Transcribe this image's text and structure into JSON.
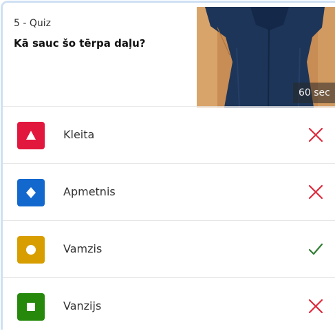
{
  "quiz": {
    "label": "5 - Quiz",
    "question": "Kā sauc šo tērpa daļu?",
    "timer": "60 sec"
  },
  "answers": [
    {
      "label": "Kleita",
      "shape": "triangle-icon",
      "color": "#e2173d",
      "correct": false
    },
    {
      "label": "Apmetnis",
      "shape": "diamond-icon",
      "color": "#1368ce",
      "correct": false
    },
    {
      "label": "Vamzis",
      "shape": "circle-icon",
      "color": "#d89e00",
      "correct": true
    },
    {
      "label": "Vanzijs",
      "shape": "square-icon",
      "color": "#26890c",
      "correct": false
    }
  ],
  "colors": {
    "incorrect": "#e0283c",
    "correct": "#2e7d32"
  }
}
